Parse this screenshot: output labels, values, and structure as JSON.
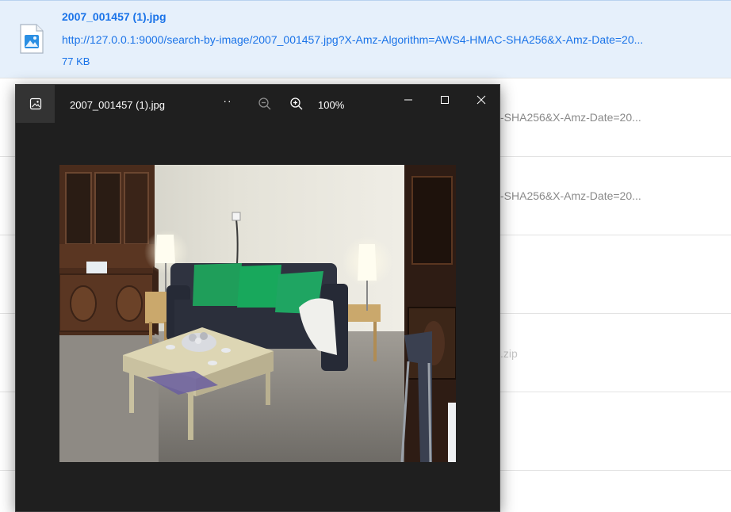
{
  "downloads": {
    "active_item": {
      "filename": "2007_001457 (1).jpg",
      "url": "http://127.0.0.1:9000/search-by-image/2007_001457.jpg?X-Amz-Algorithm=AWS4-HMAC-SHA256&X-Amz-Date=20...",
      "size": "77 KB",
      "icon": "image-file-icon"
    },
    "partial_items": [
      {
        "visible_text": "-SHA256&X-Amz-Date=20..."
      },
      {
        "visible_text": "-SHA256&X-Amz-Date=20..."
      },
      {
        "visible_text": ".zip"
      }
    ]
  },
  "viewer": {
    "title": "2007_001457 (1).jpg",
    "zoom_level": "100%",
    "icons": [
      "photos-app-icon",
      "more-options-icon",
      "zoom-out-icon",
      "zoom-in-icon",
      "minimize-icon",
      "maximize-icon",
      "close-icon"
    ],
    "colors": {
      "background": "#1f1f1f",
      "titlebar_icon_bg": "#333333",
      "text": "#ffffff"
    }
  },
  "colors": {
    "link_blue": "#1a73e8",
    "active_row_bg": "#e6f0fb"
  }
}
